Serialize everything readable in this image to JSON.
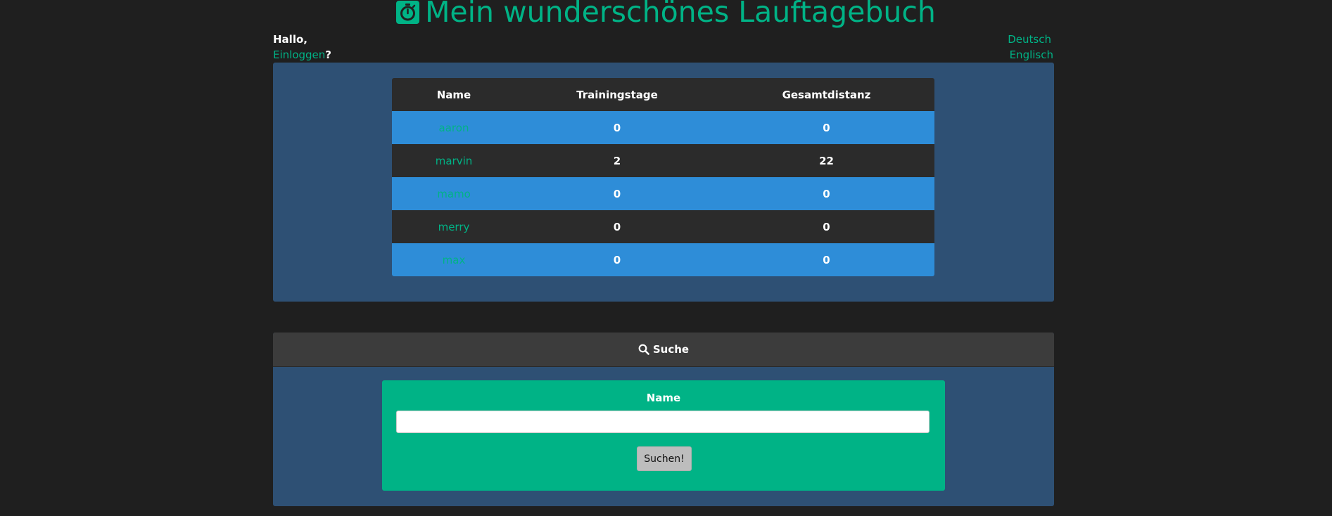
{
  "header": {
    "title": "Mein wunderschönes Lauftagebuch",
    "greeting": "Hallo,",
    "login_link": "Einloggen",
    "login_suffix": "?"
  },
  "languages": [
    "Deutsch",
    "Englisch"
  ],
  "table": {
    "columns": [
      "Name",
      "Trainingstage",
      "Gesamtdistanz"
    ],
    "rows": [
      {
        "name": "aaron",
        "days": "0",
        "distance": "0"
      },
      {
        "name": "marvin",
        "days": "2",
        "distance": "22"
      },
      {
        "name": "mamo",
        "days": "0",
        "distance": "0"
      },
      {
        "name": "merry",
        "days": "0",
        "distance": "0"
      },
      {
        "name": "max",
        "days": "0",
        "distance": "0"
      }
    ]
  },
  "search": {
    "header": "Suche",
    "label": "Name",
    "input_value": "",
    "button": "Suchen!"
  },
  "colors": {
    "accent": "#00b386",
    "background": "#1f1f1f",
    "panel": "#2e5074",
    "row_blue": "#2e8dd8",
    "row_dark": "#2b2b2b"
  },
  "icons": {
    "title": "stopwatch-icon",
    "search": "search-icon"
  }
}
